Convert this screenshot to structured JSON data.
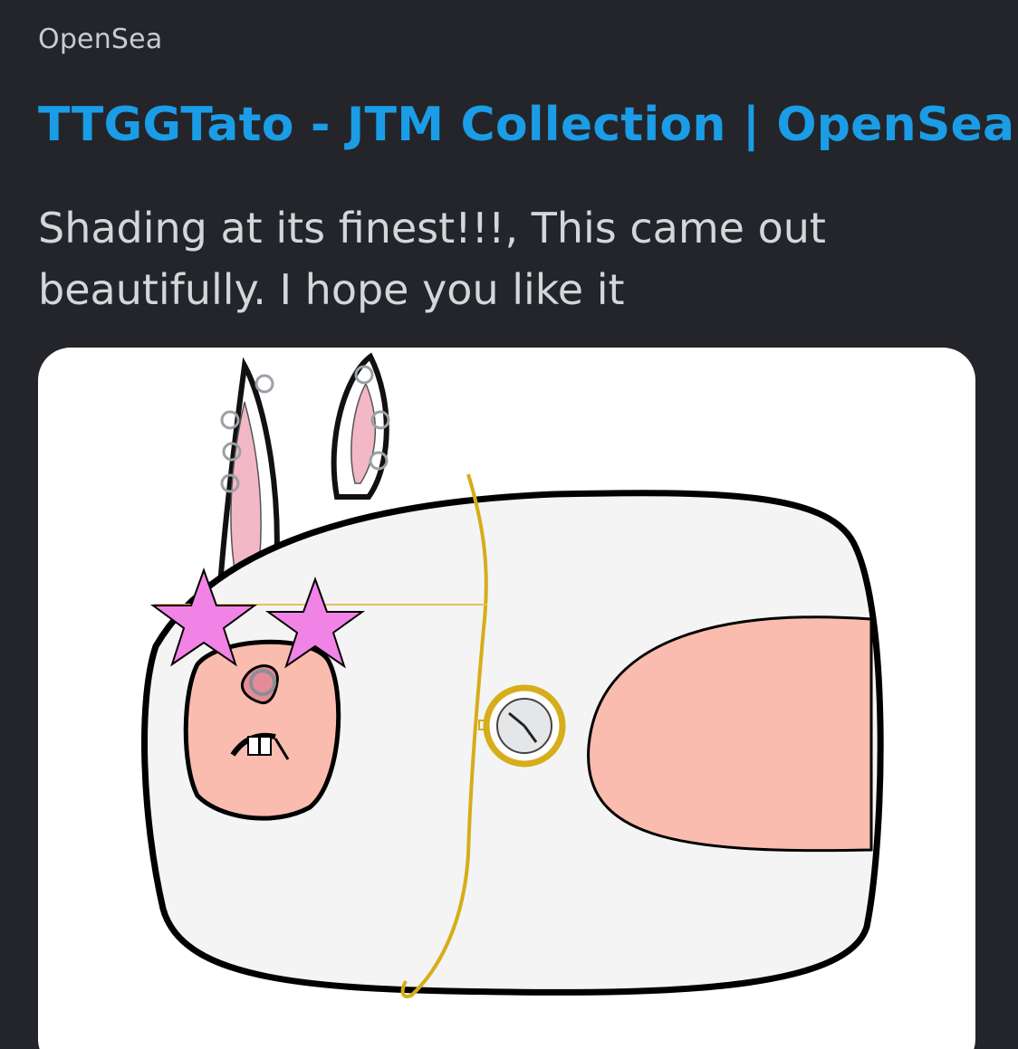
{
  "embed": {
    "provider": "OpenSea",
    "title": "TTGGTato - JTM Collection | OpenSea",
    "description": "Shading at its finest!!!, This came out beautifully. I hope you like it",
    "image_alt": "bunny-potato-nft-artwork"
  },
  "colors": {
    "background": "#24252a",
    "provider_text": "#c9cbd0",
    "title_link": "#1a9de6",
    "description_text": "#d4d6da",
    "image_background": "#ffffff"
  }
}
